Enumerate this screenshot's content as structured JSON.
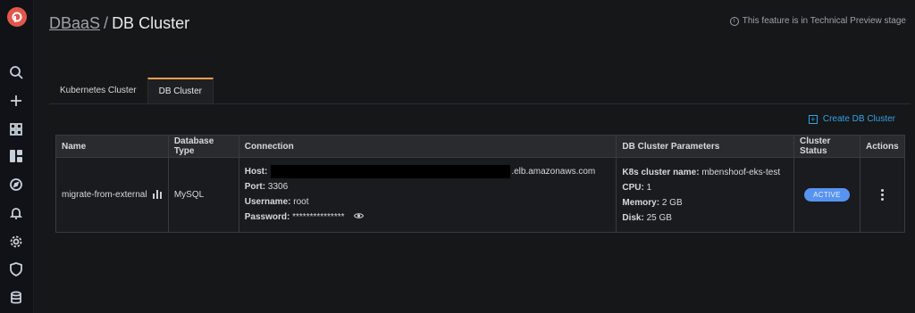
{
  "colors": {
    "accent": "#33a2e5",
    "badge": "#5794f2",
    "tab_highlight": "#f29d4b",
    "logo": "#e2574c"
  },
  "sidebar": {
    "icons": [
      "logo-icon",
      "search-icon",
      "plus-icon",
      "dashboards-icon",
      "dbaas-icon",
      "explore-icon",
      "alert-bell-icon",
      "settings-gear-icon",
      "shield-icon",
      "database-icon"
    ]
  },
  "breadcrumb": {
    "parent": "DBaaS",
    "separator": "/",
    "current": "DB Cluster"
  },
  "preview_notice": "This feature is in Technical Preview stage",
  "tabs": [
    {
      "label": "Kubernetes Cluster"
    },
    {
      "label": "DB Cluster"
    }
  ],
  "create_button": "Create DB Cluster",
  "table": {
    "headers": [
      "Name",
      "Database Type",
      "Connection",
      "DB Cluster Parameters",
      "Cluster Status",
      "Actions"
    ],
    "rows": [
      {
        "name": "migrate-from-external",
        "db_type": "MySQL",
        "connection": {
          "host_label": "Host:",
          "host_suffix": ".elb.amazonaws.com",
          "port_label": "Port:",
          "port": "3306",
          "username_label": "Username:",
          "username": "root",
          "password_label": "Password:",
          "password": "***************"
        },
        "params": {
          "k8s_label": "K8s cluster name:",
          "k8s": "mbenshoof-eks-test",
          "cpu_label": "CPU:",
          "cpu": "1",
          "memory_label": "Memory:",
          "memory": "2 GB",
          "disk_label": "Disk:",
          "disk": "25 GB"
        },
        "status": "ACTIVE"
      }
    ]
  }
}
